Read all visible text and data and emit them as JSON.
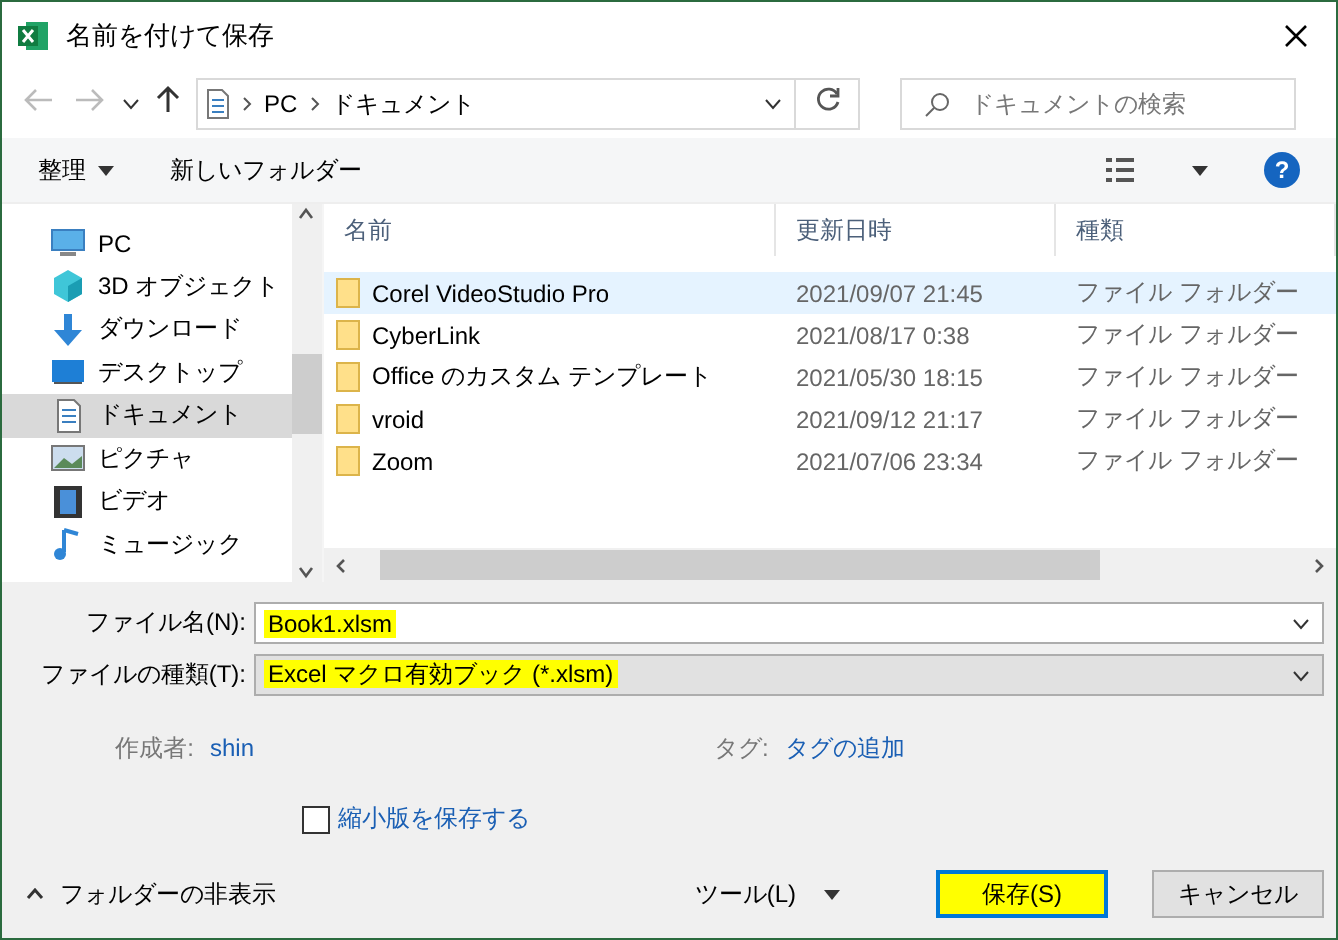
{
  "window": {
    "title": "名前を付けて保存"
  },
  "address": {
    "path": [
      "PC",
      "ドキュメント"
    ]
  },
  "search": {
    "placeholder": "ドキュメントの検索"
  },
  "toolbar": {
    "organize": "整理",
    "new_folder": "新しいフォルダー",
    "help": "?"
  },
  "sidebar": {
    "items": [
      {
        "label": "PC",
        "kind": "pc",
        "selected": false
      },
      {
        "label": "3D オブジェクト",
        "kind": "cube",
        "selected": false
      },
      {
        "label": "ダウンロード",
        "kind": "download",
        "selected": false
      },
      {
        "label": "デスクトップ",
        "kind": "desktop",
        "selected": false
      },
      {
        "label": "ドキュメント",
        "kind": "document",
        "selected": true
      },
      {
        "label": "ピクチャ",
        "kind": "picture",
        "selected": false
      },
      {
        "label": "ビデオ",
        "kind": "video",
        "selected": false
      },
      {
        "label": "ミュージック",
        "kind": "music",
        "selected": false
      }
    ]
  },
  "table": {
    "columns": [
      "名前",
      "更新日時",
      "種類"
    ],
    "rows": [
      {
        "name": "Corel VideoStudio Pro",
        "date": "2021/09/07 21:45",
        "type": "ファイル フォルダー",
        "selected": true
      },
      {
        "name": "CyberLink",
        "date": "2021/08/17 0:38",
        "type": "ファイル フォルダー",
        "selected": false
      },
      {
        "name": "Office のカスタム テンプレート",
        "date": "2021/05/30 18:15",
        "type": "ファイル フォルダー",
        "selected": false
      },
      {
        "name": "vroid",
        "date": "2021/09/12 21:17",
        "type": "ファイル フォルダー",
        "selected": false
      },
      {
        "name": "Zoom",
        "date": "2021/07/06 23:34",
        "type": "ファイル フォルダー",
        "selected": false
      }
    ]
  },
  "fields": [
    {
      "label": "ファイル名(N):",
      "value": "Book1.xlsm",
      "kind": "input",
      "highlighted": true
    },
    {
      "label": "ファイルの種類(T):",
      "value": "Excel マクロ有効ブック (*.xlsm)",
      "kind": "select",
      "highlighted": true
    }
  ],
  "meta": [
    {
      "label": "作成者:",
      "value": "shin"
    },
    {
      "label": "タグ:",
      "value": "タグの追加"
    }
  ],
  "thumbnail_option": {
    "label": "縮小版を保存する",
    "checked": false
  },
  "footer": {
    "hide_folders": "フォルダーの非表示",
    "tools": "ツール(L)",
    "buttons": [
      {
        "label": "保存(S)",
        "kind": "primary",
        "highlighted": true
      },
      {
        "label": "キャンセル",
        "kind": "secondary",
        "highlighted": false
      }
    ]
  }
}
